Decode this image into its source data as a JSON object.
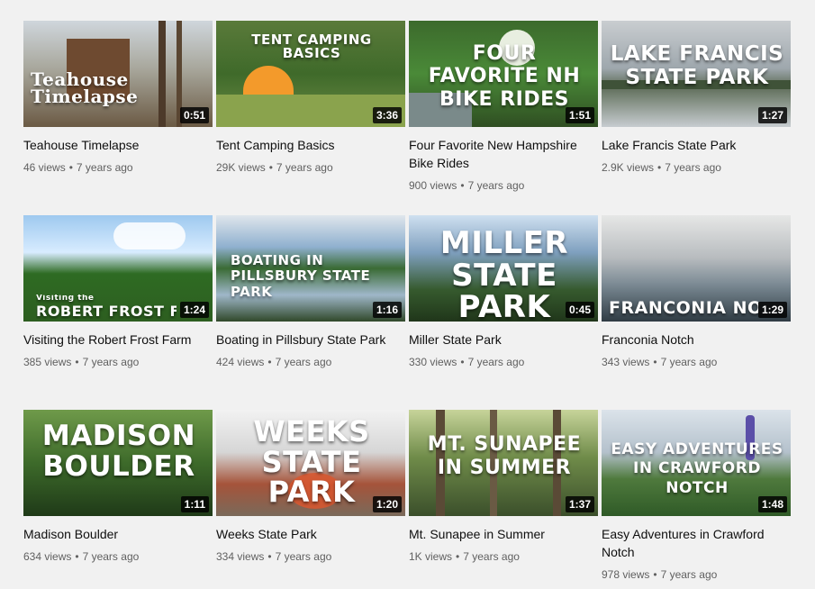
{
  "videos": [
    {
      "thumb_text": "Teahouse Timelapse",
      "duration": "0:51",
      "title": "Teahouse Timelapse",
      "views": "46 views",
      "age": "7 years ago"
    },
    {
      "thumb_text": "TENT CAMPING BASICS",
      "duration": "3:36",
      "title": "Tent Camping Basics",
      "views": "29K views",
      "age": "7 years ago"
    },
    {
      "thumb_text": "FOUR FAVORITE NH BIKE RIDES",
      "duration": "1:51",
      "title": "Four Favorite New Hampshire Bike Rides",
      "views": "900 views",
      "age": "7 years ago"
    },
    {
      "thumb_text": "LAKE FRANCIS STATE PARK",
      "duration": "1:27",
      "title": "Lake Francis State Park",
      "views": "2.9K views",
      "age": "7 years ago"
    },
    {
      "thumb_small": "Visiting the",
      "thumb_text": "ROBERT FROST FA",
      "duration": "1:24",
      "title": "Visiting the Robert Frost Farm",
      "views": "385 views",
      "age": "7 years ago"
    },
    {
      "thumb_text": "BOATING in PILLSBURY STATE PARK",
      "duration": "1:16",
      "title": "Boating in Pillsbury State Park",
      "views": "424 views",
      "age": "7 years ago"
    },
    {
      "thumb_text": "MILLER STATE PARK",
      "duration": "0:45",
      "title": "Miller State Park",
      "views": "330 views",
      "age": "7 years ago"
    },
    {
      "thumb_text": "FRANCONIA NOT",
      "duration": "1:29",
      "title": "Franconia Notch",
      "views": "343 views",
      "age": "7 years ago"
    },
    {
      "thumb_text": "MADISON BOULDER",
      "duration": "1:11",
      "title": "Madison Boulder",
      "views": "634 views",
      "age": "7 years ago"
    },
    {
      "thumb_text": "WEEKS STATE PARK",
      "duration": "1:20",
      "title": "Weeks State Park",
      "views": "334 views",
      "age": "7 years ago"
    },
    {
      "thumb_text": "MT. SUNAPEE IN SUMMER",
      "duration": "1:37",
      "title": "Mt. Sunapee in Summer",
      "views": "1K views",
      "age": "7 years ago"
    },
    {
      "thumb_text": "EASY ADVENTURES IN CRAWFORD NOTCH",
      "duration": "1:48",
      "title": "Easy Adventures in Crawford Notch",
      "views": "978 views",
      "age": "7 years ago"
    }
  ],
  "meta_separator": "•",
  "colors": {
    "background": "#f1f1f1",
    "title_text": "#0f0f0f",
    "meta_text": "#606060",
    "duration_badge": "#000000"
  }
}
